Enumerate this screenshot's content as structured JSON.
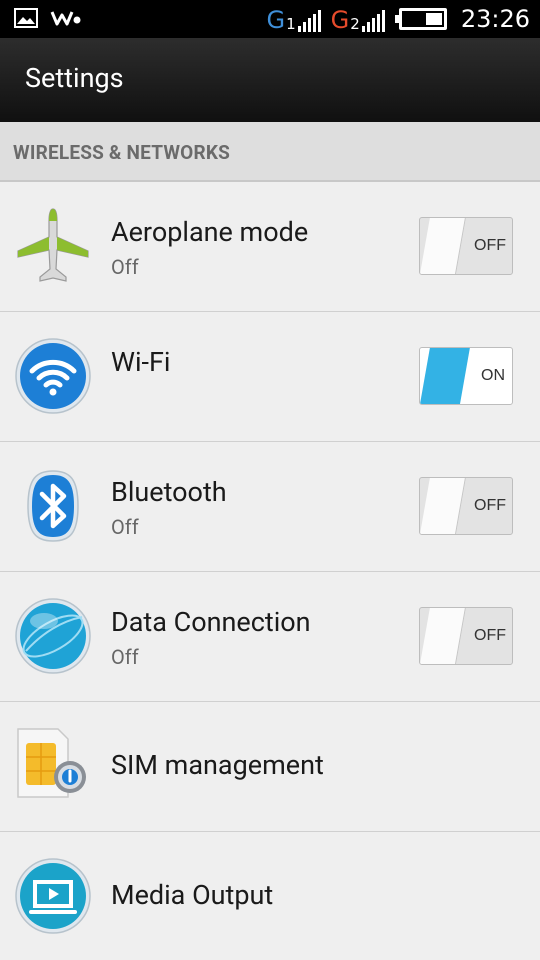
{
  "status_bar": {
    "sim1_label": "G",
    "sim1_slot": "1",
    "sim2_label": "G",
    "sim2_slot": "2",
    "time": "23:26"
  },
  "action_bar": {
    "title": "Settings"
  },
  "section": {
    "label": "WIRELESS & NETWORKS"
  },
  "rows": [
    {
      "title": "Aeroplane mode",
      "subtitle": "Off",
      "icon": "airplane-icon",
      "toggle": "OFF"
    },
    {
      "title": "Wi-Fi",
      "subtitle": "",
      "icon": "wifi-icon",
      "toggle": "ON"
    },
    {
      "title": "Bluetooth",
      "subtitle": "Off",
      "icon": "bluetooth-icon",
      "toggle": "OFF"
    },
    {
      "title": "Data Connection",
      "subtitle": "Off",
      "icon": "globe-icon",
      "toggle": "OFF"
    },
    {
      "title": "SIM management",
      "subtitle": "",
      "icon": "sim-card-icon"
    },
    {
      "title": "Media Output",
      "subtitle": "",
      "icon": "media-output-icon"
    }
  ],
  "colors": {
    "accent": "#33b2e5",
    "icon_blue": "#1d7fd6",
    "sim_yellow": "#f4bb2b"
  }
}
